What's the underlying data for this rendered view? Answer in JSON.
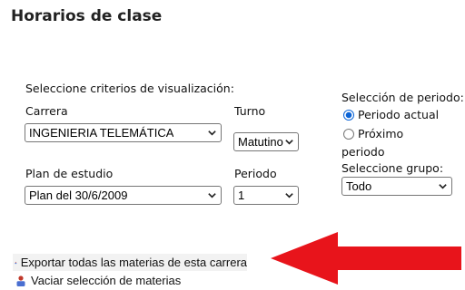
{
  "page": {
    "title": "Horarios de clase"
  },
  "criteria": {
    "heading": "Seleccione criterios de visualización:",
    "carrera_label": "Carrera",
    "carrera_value": "INGENIERIA TELEMÁTICA",
    "turno_label": "Turno",
    "turno_value": "Matutino",
    "plan_label": "Plan de estudio",
    "plan_value": "Plan del 30/6/2009",
    "periodo_label": "Periodo",
    "periodo_value": "1"
  },
  "period_selection": {
    "heading": "Selección de periodo:",
    "option_actual": "Periodo actual",
    "option_proximo_line1": "Próximo",
    "option_proximo_line2": "periodo",
    "selected": "actual"
  },
  "group": {
    "label": "Seleccione grupo:",
    "value": "Todo"
  },
  "actions": {
    "export_label": "Exportar todas las materias de esta carrera",
    "clear_label": "Vaciar selección de materias"
  },
  "colors": {
    "arrow": "#e8141b",
    "radio_accent": "#0b63d6",
    "action_icon": "#4a6fd1"
  },
  "icons": {
    "select_chevron": "chevron-down-icon",
    "export": "user-export-icon",
    "clear": "user-clear-icon"
  }
}
